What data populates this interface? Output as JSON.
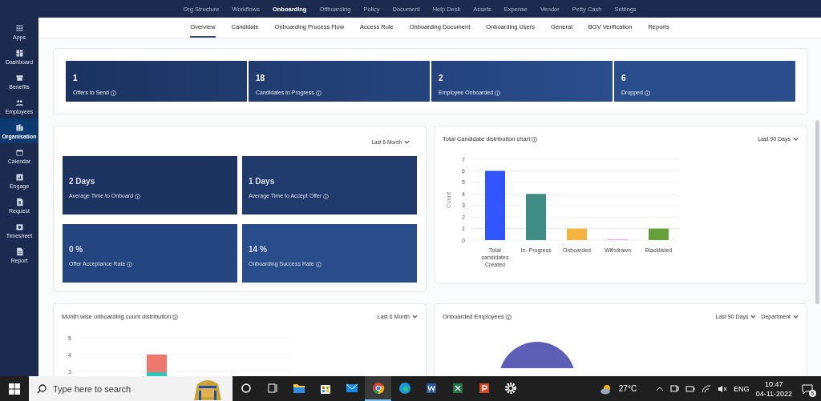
{
  "sidebar": {
    "items": [
      {
        "label": "Apps",
        "selected": false
      },
      {
        "label": "Dashboard",
        "selected": false
      },
      {
        "label": "Benefits",
        "selected": false
      },
      {
        "label": "Employees",
        "selected": false
      },
      {
        "label": "Organisation",
        "selected": true
      },
      {
        "label": "Calendar",
        "selected": false
      },
      {
        "label": "Engage",
        "selected": false
      },
      {
        "label": "Request",
        "selected": false
      },
      {
        "label": "Timesheet",
        "selected": false
      },
      {
        "label": "Report",
        "selected": false
      }
    ]
  },
  "top_nav": {
    "items": [
      {
        "label": "Org Structure",
        "selected": false
      },
      {
        "label": "Workflows",
        "selected": false
      },
      {
        "label": "Onboarding",
        "selected": true
      },
      {
        "label": "Offboarding",
        "selected": false
      },
      {
        "label": "Policy",
        "selected": false
      },
      {
        "label": "Document",
        "selected": false
      },
      {
        "label": "Help Desk",
        "selected": false
      },
      {
        "label": "Assets",
        "selected": false
      },
      {
        "label": "Expense",
        "selected": false
      },
      {
        "label": "Vendor",
        "selected": false
      },
      {
        "label": "Petty Cash",
        "selected": false
      },
      {
        "label": "Settings",
        "selected": false
      }
    ]
  },
  "tabs": [
    {
      "label": "Overview",
      "selected": true
    },
    {
      "label": "Candidate",
      "selected": false
    },
    {
      "label": "Onboarding Process Flow",
      "selected": false
    },
    {
      "label": "Access Rule",
      "selected": false
    },
    {
      "label": "Onboarding Document",
      "selected": false
    },
    {
      "label": "Onboarding Users",
      "selected": false
    },
    {
      "label": "General",
      "selected": false
    },
    {
      "label": "BGV Verification",
      "selected": false
    },
    {
      "label": "Reports",
      "selected": false
    }
  ],
  "summary_tiles": [
    {
      "value": "1",
      "label": "Offers to Send"
    },
    {
      "value": "18",
      "label": "Candidates in Progress"
    },
    {
      "value": "2",
      "label": "Employee Onboarded"
    },
    {
      "value": "6",
      "label": "Dropped"
    }
  ],
  "metrics_card": {
    "period": "Last 6 Month",
    "tiles": [
      {
        "value": "2 Days",
        "label": "Average Time to Onboard"
      },
      {
        "value": "1 Days",
        "label": "Average Time to Accept Offer"
      },
      {
        "value": "0 %",
        "label": "Offer Acceptance Rate"
      },
      {
        "value": "14 %",
        "label": "Onboarding Success Rate"
      }
    ]
  },
  "distribution_card": {
    "title": "Total Candidate distribution chart",
    "period": "Last 90 Days",
    "chart_data": {
      "type": "bar",
      "ylabel": "Count",
      "categories": [
        "Total candidates Created",
        "In- Progress",
        "Onboarded",
        "Withdrawn",
        "Blacklisted"
      ],
      "values": [
        6,
        4,
        1,
        0,
        1
      ],
      "grid": true,
      "colors": [
        "#3355ff",
        "#3f8c84",
        "#f3b53f",
        "#e9a3e6",
        "#67a03a"
      ],
      "ylim": [
        0,
        7
      ],
      "yticks": [
        0,
        1,
        2,
        3,
        4,
        5,
        6,
        7
      ]
    }
  },
  "monthly_card": {
    "title": "Month wise onboarding count distribution",
    "period": "Last 6 Month",
    "y_tick_labels": [
      "5",
      "4",
      "3"
    ]
  },
  "employees_card": {
    "title": "Onboarded Employees",
    "filters": [
      "Last 90 Days",
      "Department"
    ]
  },
  "taskbar": {
    "search_placeholder": "Type here to search",
    "apps": [
      {
        "kind": "cortana",
        "active": false
      },
      {
        "kind": "taskview",
        "active": false
      },
      {
        "kind": "files",
        "active": false
      },
      {
        "kind": "store",
        "active": false
      },
      {
        "kind": "mail",
        "active": false
      },
      {
        "kind": "chrome",
        "active": true
      },
      {
        "kind": "edge",
        "active": false
      },
      {
        "kind": "word",
        "active": false
      },
      {
        "kind": "excel",
        "active": false
      },
      {
        "kind": "powerpoint",
        "active": false
      },
      {
        "kind": "settings",
        "active": false
      }
    ],
    "temperature": "27°C",
    "language": "ENG",
    "time": "10:47",
    "date": "04-11-2022",
    "notifications": "5"
  }
}
